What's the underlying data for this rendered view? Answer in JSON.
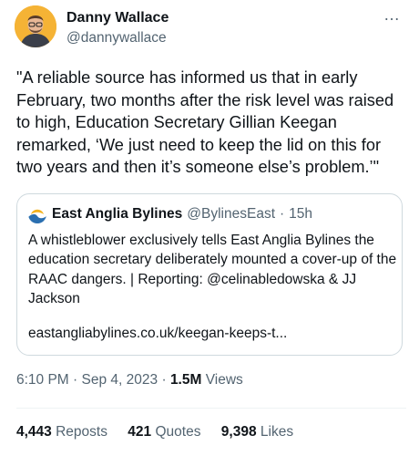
{
  "author": {
    "display_name": "Danny Wallace",
    "handle": "@dannywallace",
    "avatar_icon": "person-avatar-icon"
  },
  "more_icon": "…",
  "tweet": {
    "text": "\"A reliable source has informed us that in early February, two months after the risk level was raised to high, Education Secretary Gillian Keegan remarked, ‘We just need to keep the lid on this for two years and then it’s someone else’s problem.’\""
  },
  "quoted": {
    "display_name": "East Anglia Bylines",
    "handle": "@BylinesEast",
    "separator": "·",
    "age": "15h",
    "text": "A whistleblower exclusively tells East Anglia Bylines the education secretary deliberately mounted a cover-up of the RAAC dangers. | Reporting: @celinabledowska & JJ Jackson",
    "link": "eastangliabylines.co.uk/keegan-keeps-t..."
  },
  "meta": {
    "time": "6:10 PM",
    "dot1": "·",
    "date": "Sep 4, 2023",
    "dot2": "·",
    "views": "1.5M",
    "views_label": "Views"
  },
  "stats": {
    "reposts": "4,443",
    "reposts_label": "Reposts",
    "quotes": "421",
    "quotes_label": "Quotes",
    "likes": "9,398",
    "likes_label": "Likes"
  },
  "colors": {
    "text": "#0f1419",
    "secondary": "#536471",
    "border": "#cfd9de",
    "avatar_bg": "#f5b335"
  }
}
